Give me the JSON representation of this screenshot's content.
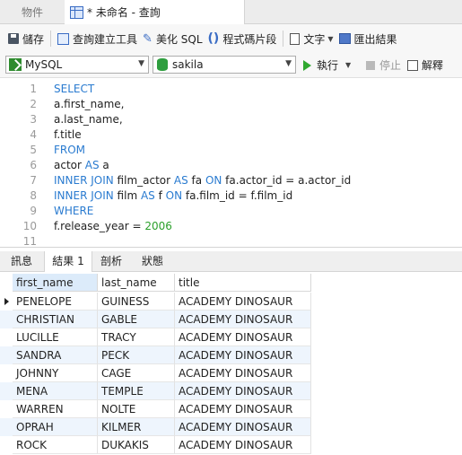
{
  "tabs": {
    "objects": "物件",
    "query": "* 未命名 - 查詢"
  },
  "toolbar": {
    "save": "儲存",
    "query_builder": "查詢建立工具",
    "beautify": "美化 SQL",
    "code_snippet": "程式碼片段",
    "text": "文字",
    "export": "匯出結果"
  },
  "connection": {
    "server": "MySQL",
    "database": "sakila",
    "run": "執行",
    "stop": "停止",
    "explain": "解釋"
  },
  "editor": {
    "lines": [
      {
        "n": "1",
        "tokens": [
          {
            "t": "SELECT",
            "k": "kw"
          }
        ]
      },
      {
        "n": "2",
        "tokens": [
          {
            "t": "a.first_name,",
            "k": ""
          }
        ]
      },
      {
        "n": "3",
        "tokens": [
          {
            "t": "a.last_name,",
            "k": ""
          }
        ]
      },
      {
        "n": "4",
        "tokens": [
          {
            "t": "f.title",
            "k": ""
          }
        ]
      },
      {
        "n": "5",
        "tokens": [
          {
            "t": "FROM",
            "k": "kw"
          }
        ]
      },
      {
        "n": "6",
        "tokens": [
          {
            "t": "actor ",
            "k": ""
          },
          {
            "t": "AS",
            "k": "kw"
          },
          {
            "t": " a",
            "k": ""
          }
        ]
      },
      {
        "n": "7",
        "tokens": [
          {
            "t": "INNER JOIN",
            "k": "kw"
          },
          {
            "t": " film_actor ",
            "k": ""
          },
          {
            "t": "AS",
            "k": "kw"
          },
          {
            "t": " fa ",
            "k": ""
          },
          {
            "t": "ON",
            "k": "kw"
          },
          {
            "t": " fa.actor_id = a.actor_id",
            "k": ""
          }
        ]
      },
      {
        "n": "8",
        "tokens": [
          {
            "t": "INNER JOIN",
            "k": "kw"
          },
          {
            "t": " film ",
            "k": ""
          },
          {
            "t": "AS",
            "k": "kw"
          },
          {
            "t": " f ",
            "k": ""
          },
          {
            "t": "ON",
            "k": "kw"
          },
          {
            "t": " fa.film_id = f.film_id",
            "k": ""
          }
        ]
      },
      {
        "n": "9",
        "tokens": [
          {
            "t": "WHERE",
            "k": "kw"
          }
        ]
      },
      {
        "n": "10",
        "tokens": [
          {
            "t": "f.release_year = ",
            "k": ""
          },
          {
            "t": "2006",
            "k": "num"
          }
        ]
      },
      {
        "n": "11",
        "tokens": []
      }
    ]
  },
  "result_tabs": {
    "message": "訊息",
    "result1": "結果 1",
    "profile": "剖析",
    "status": "狀態"
  },
  "grid": {
    "columns": [
      "first_name",
      "last_name",
      "title"
    ],
    "rows": [
      [
        "PENELOPE",
        "GUINESS",
        "ACADEMY DINOSAUR"
      ],
      [
        "CHRISTIAN",
        "GABLE",
        "ACADEMY DINOSAUR"
      ],
      [
        "LUCILLE",
        "TRACY",
        "ACADEMY DINOSAUR"
      ],
      [
        "SANDRA",
        "PECK",
        "ACADEMY DINOSAUR"
      ],
      [
        "JOHNNY",
        "CAGE",
        "ACADEMY DINOSAUR"
      ],
      [
        "MENA",
        "TEMPLE",
        "ACADEMY DINOSAUR"
      ],
      [
        "WARREN",
        "NOLTE",
        "ACADEMY DINOSAUR"
      ],
      [
        "OPRAH",
        "KILMER",
        "ACADEMY DINOSAUR"
      ],
      [
        "ROCK",
        "DUKAKIS",
        "ACADEMY DINOSAUR"
      ]
    ]
  }
}
